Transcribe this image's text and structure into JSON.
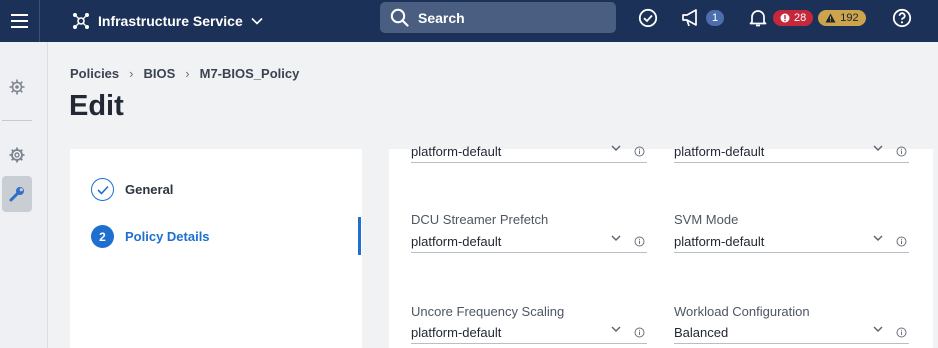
{
  "topbar": {
    "service_label": "Infrastructure Service",
    "search_placeholder": "Search",
    "announcements_count": "1",
    "alarms_critical": "28",
    "alarms_warning": "192"
  },
  "breadcrumb": {
    "items": [
      "Policies",
      "BIOS",
      "M7-BIOS_Policy"
    ]
  },
  "page_title": "Edit",
  "steps": [
    {
      "number": "1",
      "label": "General",
      "state": "done"
    },
    {
      "number": "2",
      "label": "Policy Details",
      "state": "active"
    }
  ],
  "form": {
    "fields": [
      {
        "label": "",
        "value": "platform-default"
      },
      {
        "label": "",
        "value": "platform-default"
      },
      {
        "label": "DCU Streamer Prefetch",
        "value": "platform-default"
      },
      {
        "label": "SVM Mode",
        "value": "platform-default"
      },
      {
        "label": "Uncore Frequency Scaling",
        "value": "platform-default"
      },
      {
        "label": "Workload Configuration",
        "value": "Balanced"
      }
    ]
  },
  "colors": {
    "topbar": "#1c3157",
    "accent": "#1e6fd0",
    "critical": "#c4283a",
    "warning": "#cba44b"
  },
  "icons": [
    "menu-icon",
    "service-icon",
    "chevron-down-icon",
    "search-icon",
    "check-circle-icon",
    "megaphone-icon",
    "bell-icon",
    "help-icon",
    "gear-icon",
    "wrench-icon",
    "info-icon"
  ]
}
